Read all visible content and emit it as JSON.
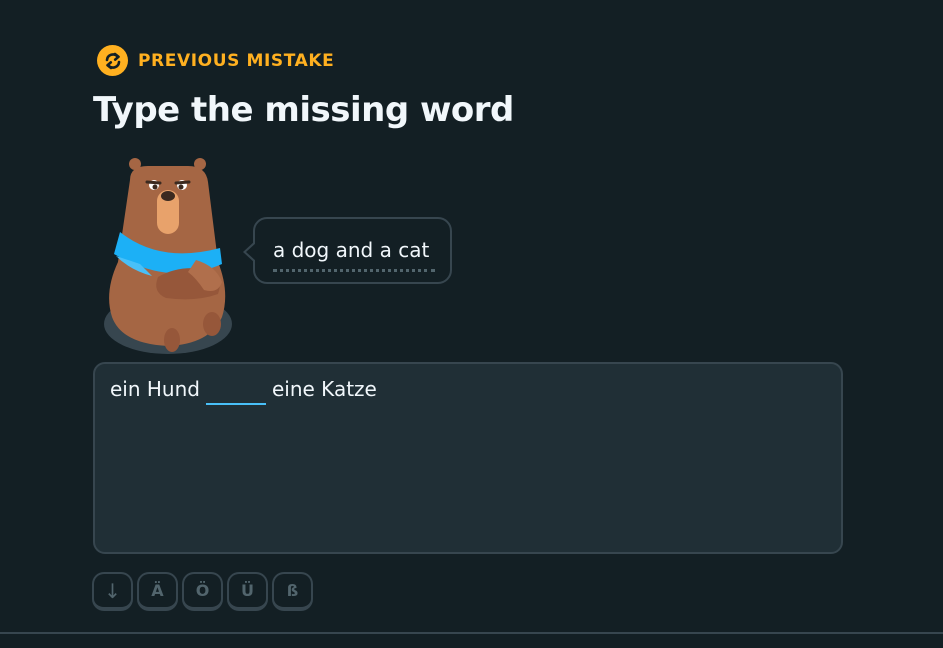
{
  "header": {
    "mistake_label": "PREVIOUS MISTAKE",
    "mistake_icon": "repeat-icon",
    "accent_color": "#ffb020"
  },
  "exercise": {
    "title": "Type the missing word",
    "character": "bear-character",
    "prompt": "a dog and a cat",
    "sentence_before": "ein Hund",
    "sentence_after": "eine Katze",
    "blank_value": ""
  },
  "keyboard": {
    "keys": [
      "↓",
      "Ä",
      "Ö",
      "Ü",
      "ß"
    ]
  },
  "colors": {
    "background": "#131f24",
    "box_background": "#202f36",
    "border": "#37464f",
    "blank_underline": "#49c0f8"
  }
}
